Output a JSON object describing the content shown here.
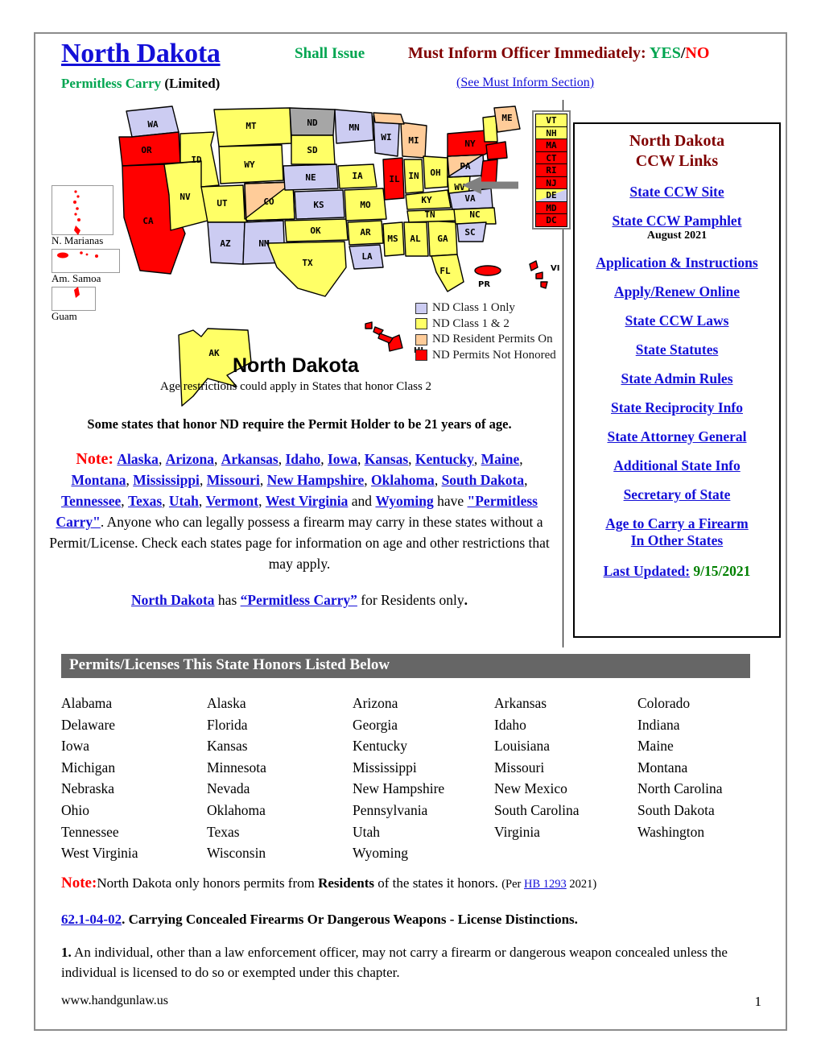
{
  "header": {
    "state_title": "North Dakota",
    "permitless_label": "Permitless Carry",
    "permitless_limited": " (Limited)",
    "shall_issue": "Shall Issue",
    "must_inform_label": "Must Inform Officer Immediately: ",
    "must_inform_yes": "YES",
    "must_inform_slash": "/",
    "must_inform_no": "NO",
    "see_must_inform": "(See Must Inform Section)"
  },
  "map": {
    "caption_title": "North Dakota",
    "caption_note": "Age restrictions  could apply in States that honor Class 2",
    "legend": [
      {
        "color": "#ccccf2",
        "label": "ND Class 1 Only"
      },
      {
        "color": "#ffff66",
        "label": "ND Class 1 & 2"
      },
      {
        "color": "#ffcc99",
        "label": "ND Resident Permits On"
      },
      {
        "color": "#ff0000",
        "label": "ND Permits Not Honored"
      }
    ],
    "territories": [
      {
        "label": "N. Marianas"
      },
      {
        "label": "Am. Samoa"
      },
      {
        "label": "Guam"
      }
    ],
    "east_strip": [
      {
        "abbr": "VT",
        "color": "#ffff66"
      },
      {
        "abbr": "NH",
        "color": "#ffff66"
      },
      {
        "abbr": "MA",
        "color": "#ff0000"
      },
      {
        "abbr": "CT",
        "color": "#ff0000"
      },
      {
        "abbr": "RI",
        "color": "#ff0000"
      },
      {
        "abbr": "NJ",
        "color": "#ff0000"
      },
      {
        "abbr": "DE",
        "color": "#ffff66"
      },
      {
        "abbr": "MD",
        "color": "#ff0000"
      },
      {
        "abbr": "DC",
        "color": "#ff0000"
      }
    ],
    "island_labels": [
      "PR",
      "VI",
      "HI"
    ]
  },
  "note21": "Some states that honor ND require the Permit Holder to be 21 years of age.",
  "note": {
    "label": "Note:",
    "states": [
      "Alaska",
      "Arizona",
      "Arkansas",
      "Idaho",
      "Iowa",
      "Kansas",
      "Kentucky",
      "Maine",
      "Montana",
      "Mississippi",
      "Missouri",
      "New Hampshire",
      "Oklahoma",
      "South Dakota",
      "Tennessee",
      "Texas",
      "Utah",
      "Vermont",
      "West Virginia"
    ],
    "and_word": "and",
    "last_state": "Wyoming",
    "have_word": "have",
    "permitless_quoted": "\"Permitless Carry\"",
    "body": ". Anyone who can legally possess a firearm may carry in these states without a Permit/License. Check each states  page for  information on age and other  restrictions that may apply."
  },
  "note_resident": {
    "state_link": "North Dakota",
    "has_word": "has",
    "permitless_quoted": "“Permitless Carry”",
    "tail": "for Residents only",
    "period": "."
  },
  "ccw": {
    "title_line1": "North Dakota",
    "title_line2": "CCW  Links",
    "links": [
      {
        "label": "State CCW Site"
      },
      {
        "label": "State CCW Pamphlet",
        "sub": "August 2021"
      },
      {
        "label": "Application & Instructions"
      },
      {
        "label": "Apply/Renew Online"
      },
      {
        "label": "State CCW Laws"
      },
      {
        "label": "State Statutes"
      },
      {
        "label": "State Admin Rules"
      },
      {
        "label": "State Reciprocity Info"
      },
      {
        "label": "State Attorney General"
      },
      {
        "label": "Additional State Info"
      },
      {
        "label": "Secretary of State"
      },
      {
        "label": "Age to Carry a Firearm"
      },
      {
        "label": "In Other States"
      }
    ],
    "last_updated_label": "Last Updated:",
    "last_updated_date": "9/15/2021"
  },
  "honors": {
    "bar_title": "Permits/Licenses This State Honors Listed Below",
    "states": [
      "Alabama",
      "Alaska",
      "Arizona",
      "Arkansas",
      "Colorado",
      "Delaware",
      "Florida",
      " Georgia",
      "Idaho",
      "Indiana",
      "Iowa",
      "Kansas",
      "Kentucky",
      "Louisiana",
      "Maine",
      "Michigan",
      "Minnesota",
      "Mississippi",
      "Missouri",
      "Montana",
      "Nebraska",
      "Nevada",
      "New Hampshire",
      "New Mexico",
      "North Carolina",
      "Ohio",
      "Oklahoma",
      "Pennsylvania",
      "South Carolina",
      "South Dakota",
      "Tennessee",
      "Texas",
      "Utah",
      "Virginia",
      "Washington",
      "West Virginia",
      "Wisconsin",
      "Wyoming"
    ]
  },
  "bottom": {
    "note_label": "Note:",
    "note_text_1": "North Dakota only honors permits from ",
    "note_bold": "Residents",
    "note_text_2": " of the states it honors.",
    "note_per": "(Per ",
    "note_bill": "HB 1293",
    "note_year": " 2021)",
    "statute_number": "62.1-04-02",
    "statute_title": ". Carrying Concealed Firearms Or Dangerous Weapons - License Distinctions.",
    "body_num": "1.",
    "body_text": " An individual, other than a law enforcement officer, may not carry a firearm or dangerous weapon concealed unless the individual is licensed to do so or exempted under this chapter.",
    "footer_url": "www.handgunlaw.us",
    "footer_page": "1"
  }
}
